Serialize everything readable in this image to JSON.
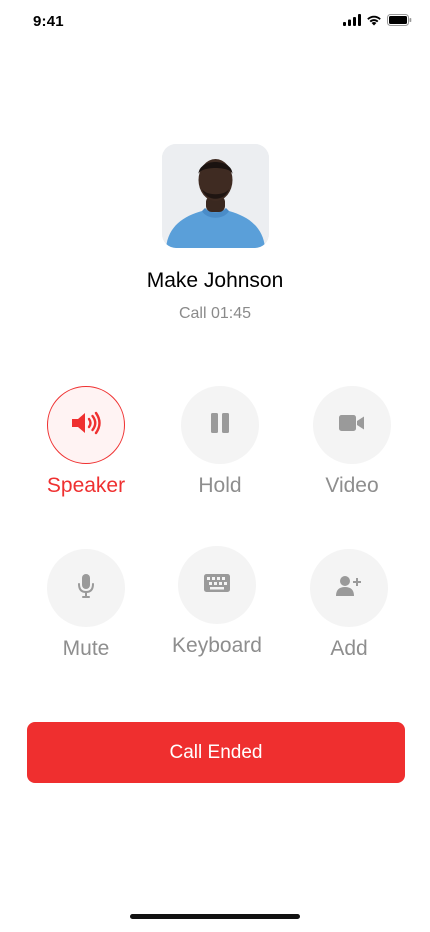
{
  "status_bar": {
    "time": "9:41",
    "icons": [
      "signal-icon",
      "wifi-icon",
      "battery-icon"
    ]
  },
  "caller": {
    "name": "Make Johnson",
    "status": "Call 01:45"
  },
  "controls": [
    {
      "label": "Speaker",
      "icon": "speaker-icon",
      "active": true
    },
    {
      "label": "Hold",
      "icon": "pause-icon",
      "active": false
    },
    {
      "label": "Video",
      "icon": "video-camera-icon",
      "active": false
    },
    {
      "label": "Mute",
      "icon": "microphone-icon",
      "active": false
    },
    {
      "label": "Keyboard",
      "icon": "keyboard-icon",
      "active": false
    },
    {
      "label": "Add",
      "icon": "add-person-icon",
      "active": false
    }
  ],
  "end_call": {
    "label": "Call Ended"
  },
  "colors": {
    "accent": "#ef3030",
    "button_bg": "#f4f4f4",
    "icon_gray": "#9a9a9a"
  }
}
